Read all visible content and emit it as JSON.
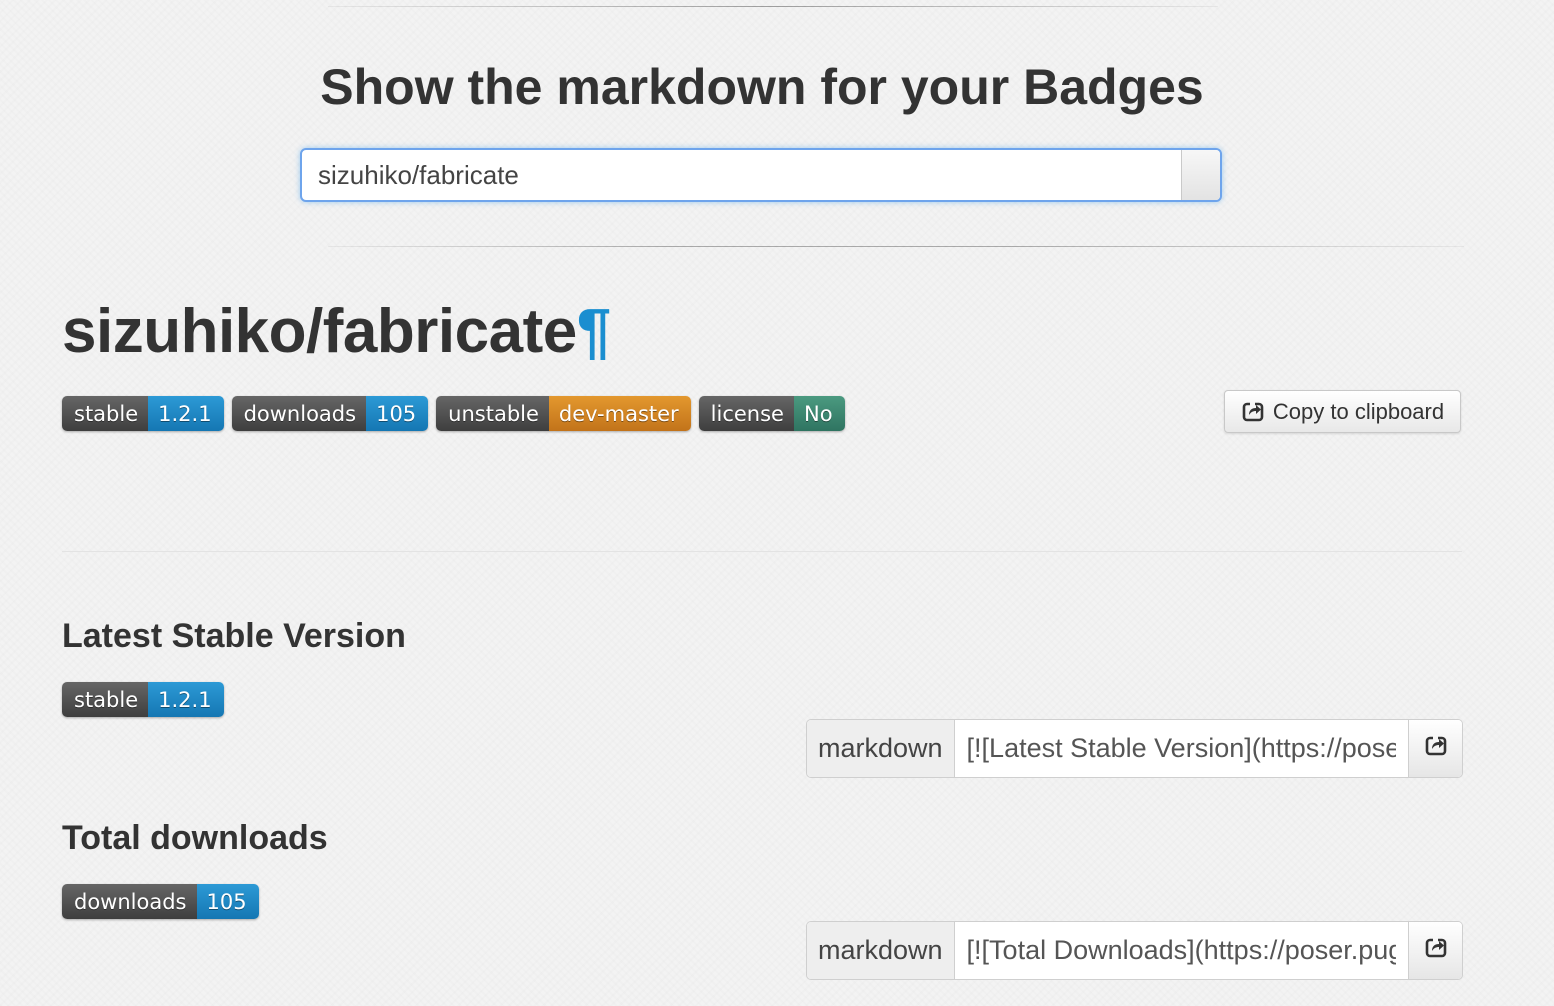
{
  "header": {
    "title": "Show the markdown for your Badges"
  },
  "search": {
    "value": "sizuhiko/fabricate"
  },
  "repo": {
    "name": "sizuhiko/fabricate",
    "anchor": "¶"
  },
  "badges": [
    {
      "label": "stable",
      "value": "1.2.1",
      "color": "#1a85c6"
    },
    {
      "label": "downloads",
      "value": "105",
      "color": "#1a85c6"
    },
    {
      "label": "unstable",
      "value": "dev-master",
      "color": "#d9862a"
    },
    {
      "label": "license",
      "value": "No",
      "color": "#3f8a72"
    }
  ],
  "copy_button": {
    "label": "Copy to clipboard",
    "icon": "share-icon"
  },
  "sections": [
    {
      "title": "Latest Stable Version",
      "badge": {
        "label": "stable",
        "value": "1.2.1"
      },
      "addon": "markdown",
      "markdown": "[![Latest Stable Version](https://poser.pugx.org/sizuhiko/fabricate/v/stable.svg)](https://packagist.org/packages/sizuhiko/fabricate)"
    },
    {
      "title": "Total downloads",
      "badge": {
        "label": "downloads",
        "value": "105"
      },
      "addon": "markdown",
      "markdown": "[![Total Downloads](https://poser.pugx.org/sizuhiko/fabricate/downloads.svg)](https://packagist.org/packages/sizuhiko/fabricate)"
    }
  ]
}
